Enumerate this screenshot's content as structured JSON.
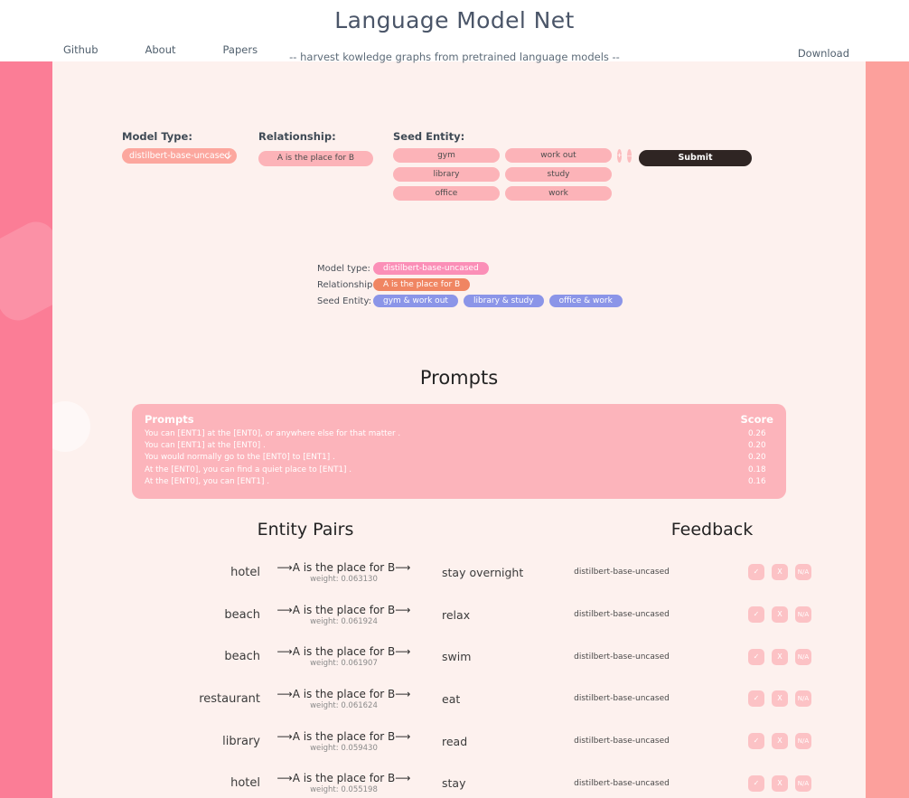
{
  "header": {
    "brand": "Language Model Net",
    "subtitle": "-- harvest kowledge graphs from pretrained language models --",
    "nav": [
      {
        "label": "Github"
      },
      {
        "label": "About"
      },
      {
        "label": "Papers"
      }
    ],
    "download_label": "Download"
  },
  "form": {
    "model_type_label": "Model Type:",
    "model_type_value": "distilbert-base-uncased",
    "relationship_label": "Relationship:",
    "relationship_value": "A is the place for B",
    "seed_entity_label": "Seed Entity:",
    "seed_rows": [
      {
        "a": "gym",
        "b": "work out"
      },
      {
        "a": "library",
        "b": "study"
      },
      {
        "a": "office",
        "b": "work"
      }
    ],
    "add_label": "+",
    "remove_label": "–",
    "submit_label": "Submit"
  },
  "summary": {
    "model_type_label": "Model type:",
    "model_type_value": "distilbert-base-uncased",
    "relationship_label": "Relationship:",
    "relationship_value": "A is the place for B",
    "seed_entity_label": "Seed Entity:",
    "seed_values": [
      "gym & work out",
      "library & study",
      "office & work"
    ]
  },
  "prompts": {
    "title": "Prompts",
    "col_prompts": "Prompts",
    "col_score": "Score",
    "rows": [
      {
        "text": "You can [ENT1] at the [ENT0], or anywhere else for that matter .",
        "score": "0.26"
      },
      {
        "text": "You can [ENT1] at the [ENT0] .",
        "score": "0.20"
      },
      {
        "text": "You would normally go to the [ENT0] to [ENT1] .",
        "score": "0.20"
      },
      {
        "text": "At the [ENT0], you can find a quiet place to [ENT1] .",
        "score": "0.18"
      },
      {
        "text": "At the [ENT0], you can [ENT1] .",
        "score": "0.16"
      }
    ]
  },
  "entity_pairs": {
    "title": "Entity Pairs",
    "feedback_title": "Feedback",
    "feedback_buttons": {
      "yes": "✓",
      "no": "X",
      "na": "N/A"
    },
    "rows": [
      {
        "subject": "hotel",
        "relation": "⟶A is the place for B⟶",
        "weight": "weight: 0.063130",
        "object": "stay overnight",
        "model": "distilbert-base-uncased"
      },
      {
        "subject": "beach",
        "relation": "⟶A is the place for B⟶",
        "weight": "weight: 0.061924",
        "object": "relax",
        "model": "distilbert-base-uncased"
      },
      {
        "subject": "beach",
        "relation": "⟶A is the place for B⟶",
        "weight": "weight: 0.061907",
        "object": "swim",
        "model": "distilbert-base-uncased"
      },
      {
        "subject": "restaurant",
        "relation": "⟶A is the place for B⟶",
        "weight": "weight: 0.061624",
        "object": "eat",
        "model": "distilbert-base-uncased"
      },
      {
        "subject": "library",
        "relation": "⟶A is the place for B⟶",
        "weight": "weight: 0.059430",
        "object": "read",
        "model": "distilbert-base-uncased"
      },
      {
        "subject": "hotel",
        "relation": "⟶A is the place for B⟶",
        "weight": "weight: 0.055198",
        "object": "stay",
        "model": "distilbert-base-uncased"
      }
    ]
  },
  "colors": {
    "band_left": "#fb7d96",
    "band_right": "#fca09c",
    "page_bg": "#fdf1ee",
    "pill_pink": "#fcb3b8",
    "select_salmon": "#fca79e",
    "tag_model": "#fb8fb7",
    "tag_relationship": "#f08562",
    "tag_seed": "#8b95e8",
    "submit_dark": "#2f2523",
    "prompt_card": "#fcb4bb"
  }
}
